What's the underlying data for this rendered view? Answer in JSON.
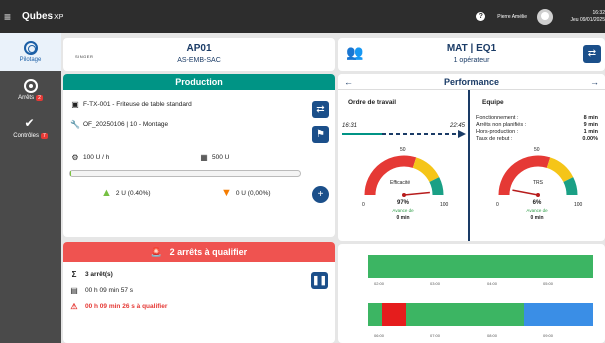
{
  "app": {
    "logo": "Qubes",
    "logo_suffix": "XP",
    "menu_icon": "hamburger-icon"
  },
  "user": {
    "name": "Pierre Amélie",
    "time": "16:32",
    "date": "Jeu 09/01/2025"
  },
  "sidebar": {
    "items": [
      {
        "label": "Pilotage",
        "icon": "steering-icon",
        "badge": ""
      },
      {
        "label": "Arrêts",
        "icon": "stop-icon",
        "badge": "2"
      },
      {
        "label": "Contrôles",
        "icon": "checklist-icon",
        "badge": "7"
      }
    ]
  },
  "ap": {
    "brand": "SINGER",
    "title": "AP01",
    "subtitle": "AS-EMB-SAC"
  },
  "mat": {
    "title": "MAT | EQ1",
    "subtitle": "1 opérateur"
  },
  "production": {
    "header": "Production",
    "article": "F-TX-001 - Friteuse de table standard",
    "of": "OF_20250106 | 10 - Montage",
    "rate": "100 U / h",
    "quantity": "500 U",
    "progress": 0.004,
    "good": "2 U (0.40%)",
    "bad": "0 U (0,00%)"
  },
  "performance": {
    "header": "Performance",
    "left_arrow": "←",
    "right_arrow": "→",
    "ordre": {
      "title": "Ordre de travail",
      "start": "16:31",
      "end": "22:45",
      "gauge_label": "Efficacité",
      "value": "97%",
      "value_num": 97,
      "avance_label": "Avance de",
      "avance": "0 min",
      "scale_min": "0",
      "scale_mid": "50",
      "scale_max": "100"
    },
    "equipe": {
      "title": "Equipe",
      "rows": [
        {
          "label": "Fonctionnement :",
          "value": "8 min"
        },
        {
          "label": "Arrêts non planifiés :",
          "value": "9 min"
        },
        {
          "label": "Hors-production :",
          "value": "1 min"
        },
        {
          "label": "Taux de rebut :",
          "value": "0.00%"
        }
      ],
      "gauge_label": "TRS",
      "value": "6%",
      "value_num": 6,
      "avance_label": "Avance de",
      "avance": "0 min",
      "scale_min": "0",
      "scale_mid": "50",
      "scale_max": "100"
    }
  },
  "arrets": {
    "header": "2 arrêts à qualifier",
    "count": "3 arrêt(s)",
    "duration": "00 h 09 min 57 s",
    "to_qualify": "00 h 09 min 26 s à qualifier"
  },
  "timeline": {
    "ticks_top": [
      "02:00",
      "03:00",
      "04:00",
      "05:00"
    ],
    "ticks_bottom": [
      "06:00",
      "07:00",
      "08:00",
      "09:00"
    ],
    "colors": {
      "run": "#3cb563",
      "stop": "#e51d1d",
      "planned": "#3a8ee6"
    }
  }
}
